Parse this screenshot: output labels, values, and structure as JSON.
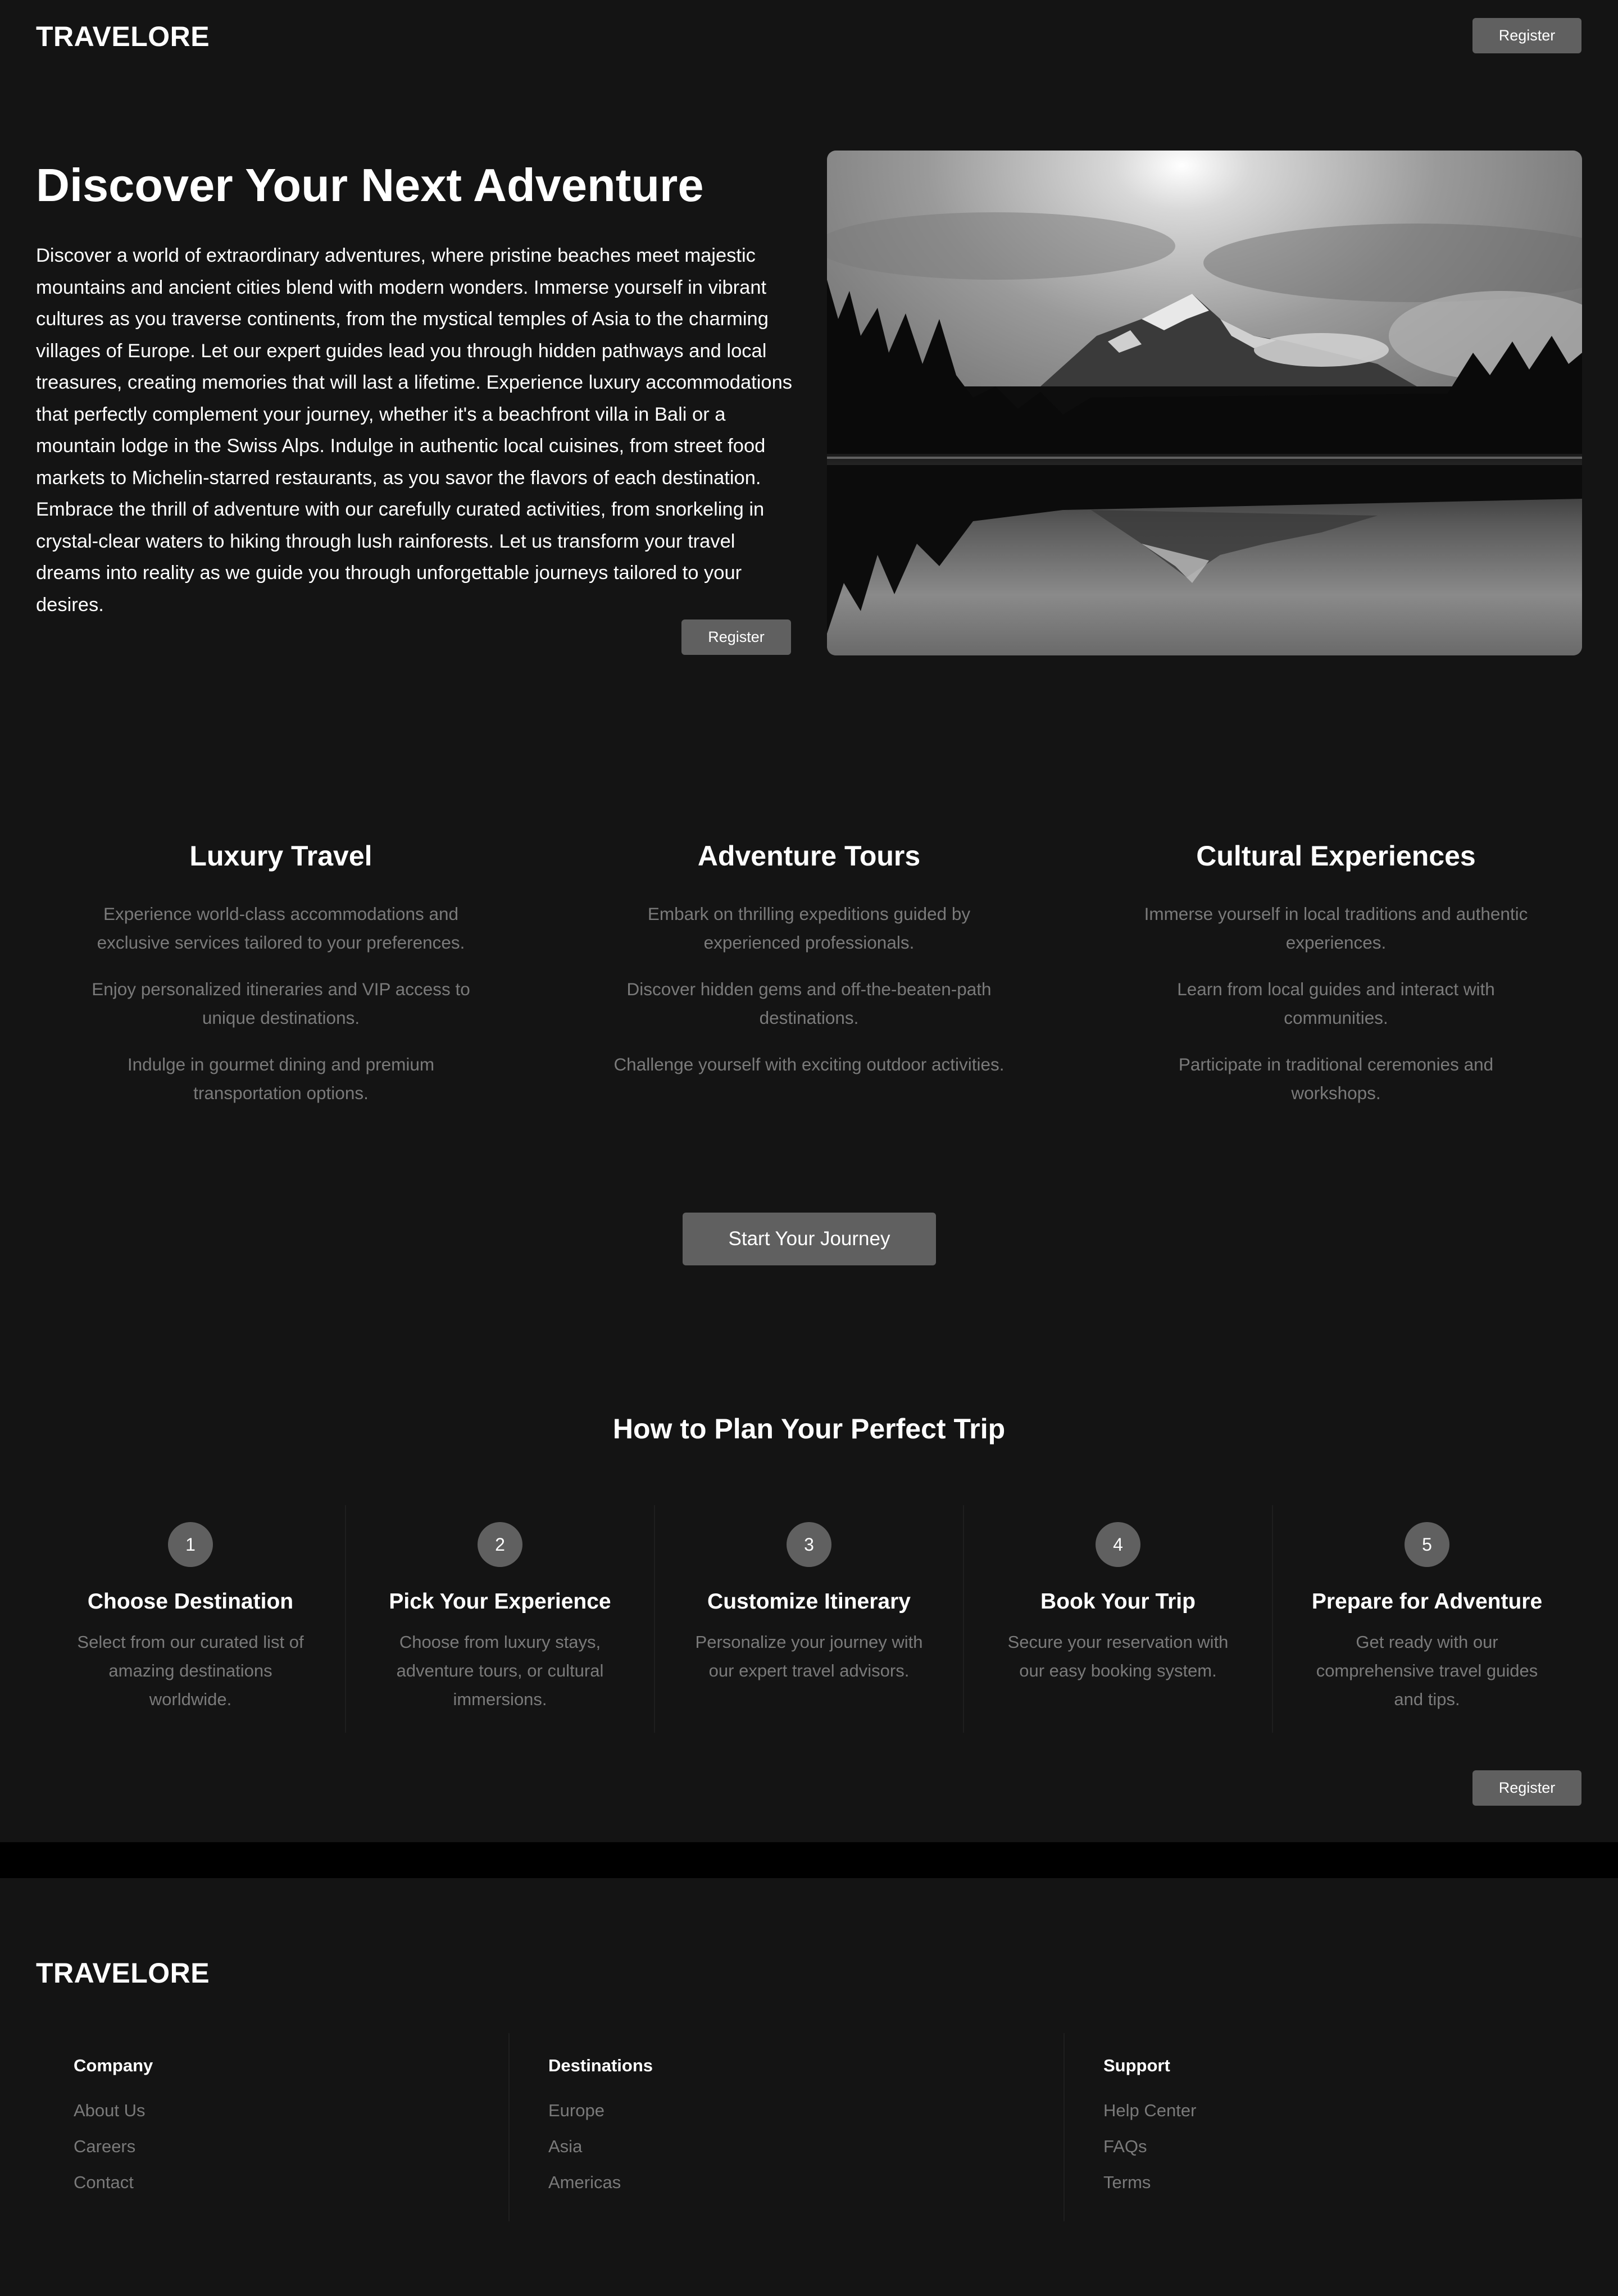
{
  "header": {
    "logo": "TRAVELORE",
    "register_label": "Register"
  },
  "hero": {
    "title": "Discover Your Next Adventure",
    "body": "Discover a world of extraordinary adventures, where pristine beaches meet majestic mountains and ancient cities blend with modern wonders. Immerse yourself in vibrant cultures as you traverse continents, from the mystical temples of Asia to the charming villages of Europe. Let our expert guides lead you through hidden pathways and local treasures, creating memories that will last a lifetime. Experience luxury accommodations that perfectly complement your journey, whether it's a beachfront villa in Bali or a mountain lodge in the Swiss Alps. Indulge in authentic local cuisines, from street food markets to Michelin-starred restaurants, as you savor the flavors of each destination. Embrace the thrill of adventure with our carefully curated activities, from snorkeling in crystal-clear waters to hiking through lush rainforests. Let us transform your travel dreams into reality as we guide you through unforgettable journeys tailored to your desires.",
    "register_label": "Register"
  },
  "features": [
    {
      "title": "Luxury Travel",
      "items": [
        "Experience world-class accommodations and exclusive services tailored to your preferences.",
        "Enjoy personalized itineraries and VIP access to unique destinations.",
        "Indulge in gourmet dining and premium transportation options."
      ]
    },
    {
      "title": "Adventure Tours",
      "items": [
        "Embark on thrilling expeditions guided by experienced professionals.",
        "Discover hidden gems and off-the-beaten-path destinations.",
        "Challenge yourself with exciting outdoor activities."
      ]
    },
    {
      "title": "Cultural Experiences",
      "items": [
        "Immerse yourself in local traditions and authentic experiences.",
        "Learn from local guides and interact with communities.",
        "Participate in traditional ceremonies and workshops."
      ]
    }
  ],
  "cta_label": "Start Your Journey",
  "steps": {
    "title": "How to Plan Your Perfect Trip",
    "items": [
      {
        "number": "1",
        "title": "Choose Destination",
        "text": "Select from our curated list of amazing destinations worldwide."
      },
      {
        "number": "2",
        "title": "Pick Your Experience",
        "text": "Choose from luxury stays, adventure tours, or cultural immersions."
      },
      {
        "number": "3",
        "title": "Customize Itinerary",
        "text": "Personalize your journey with our expert travel advisors."
      },
      {
        "number": "4",
        "title": "Book Your Trip",
        "text": "Secure your reservation with our easy booking system."
      },
      {
        "number": "5",
        "title": "Prepare for Adventure",
        "text": "Get ready with our comprehensive travel guides and tips."
      }
    ],
    "register_label": "Register"
  },
  "footer": {
    "logo": "TRAVELORE",
    "columns": [
      {
        "title": "Company",
        "links": [
          "About Us",
          "Careers",
          "Contact"
        ]
      },
      {
        "title": "Destinations",
        "links": [
          "Europe",
          "Asia",
          "Americas"
        ]
      },
      {
        "title": "Support",
        "links": [
          "Help Center",
          "FAQs",
          "Terms"
        ]
      }
    ]
  }
}
